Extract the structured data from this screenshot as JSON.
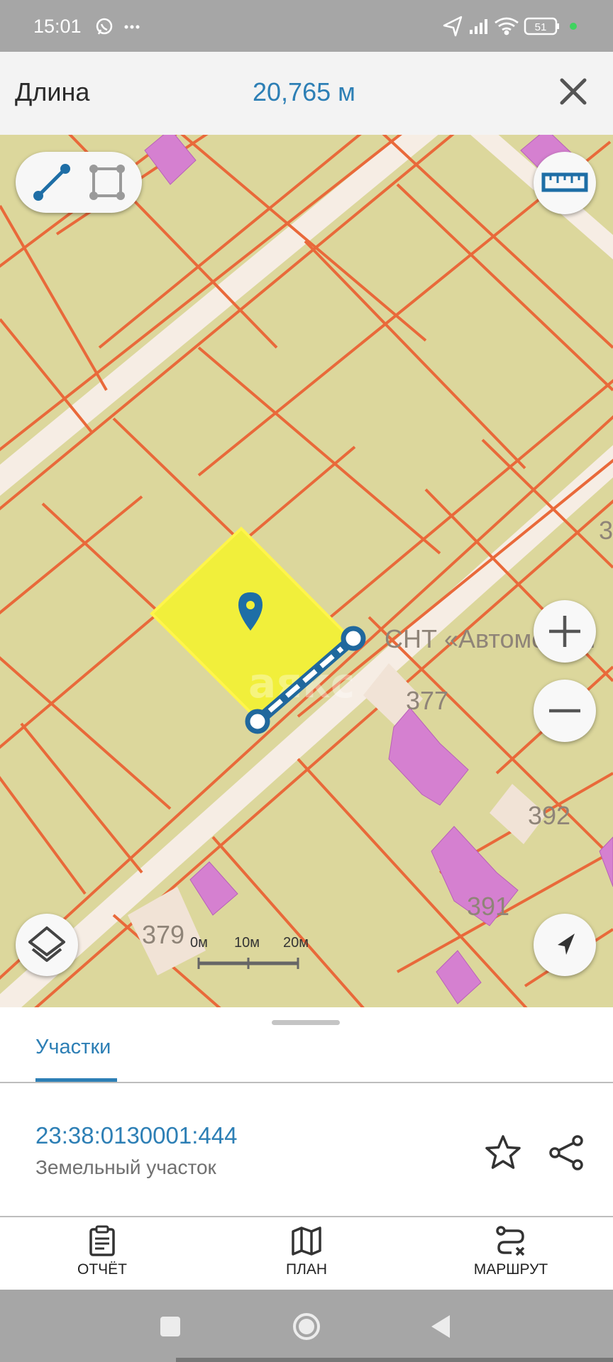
{
  "status_bar": {
    "time": "15:01",
    "battery": "51",
    "icons_left": [
      "whatsapp-icon",
      "more-dots-icon"
    ],
    "icons_right": [
      "location-arrow-icon",
      "signal-icon",
      "wifi-icon",
      "battery-icon",
      "active-dot-icon"
    ]
  },
  "header": {
    "title": "Длина",
    "value": "20,765 м",
    "close_icon": "close-icon"
  },
  "map": {
    "colors": {
      "land": "#dcd79c",
      "boundary": "#e9693a",
      "road": "#f6ede4",
      "building": "#d580d0",
      "selected_parcel": "#f1ef3b",
      "measure_line": "#20689d"
    },
    "labels": {
      "snt": "СНТ «Автомобилі",
      "plot_377": "377",
      "plot_392": "392",
      "plot_391": "391",
      "plot_379": "379",
      "edge_3": "3",
      "watermark": "аякс"
    },
    "scale": {
      "labels": [
        "0м",
        "10м",
        "20м"
      ]
    },
    "controls": {
      "mode_line_icon": "line-measure-icon",
      "mode_area_icon": "area-measure-icon",
      "ruler_icon": "ruler-icon",
      "zoom_in_icon": "plus-icon",
      "zoom_out_icon": "minus-icon",
      "layers_icon": "layers-icon",
      "locate_icon": "navigation-arrow-icon",
      "marker_icon": "map-marker-icon"
    }
  },
  "sheet": {
    "tab": "Участки",
    "parcel": {
      "id": "23:38:0130001:444",
      "type": "Земельный участок"
    }
  },
  "bottom_nav": {
    "items": [
      {
        "label": "ОТЧЁТ",
        "icon": "clipboard-icon"
      },
      {
        "label": "ПЛАН",
        "icon": "map-icon"
      },
      {
        "label": "МАРШРУТ",
        "icon": "route-icon"
      }
    ]
  },
  "system_nav": {
    "icons": [
      "square-icon",
      "circle-icon",
      "back-triangle-icon"
    ]
  }
}
